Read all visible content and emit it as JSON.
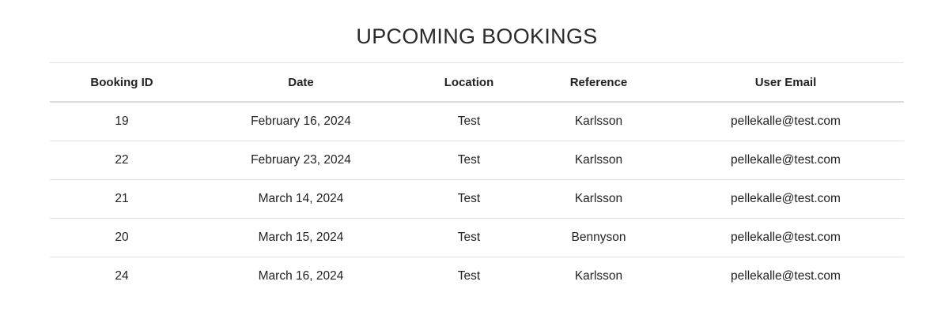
{
  "page": {
    "title": "UPCOMING BOOKINGS"
  },
  "table": {
    "headers": [
      "Booking ID",
      "Date",
      "Location",
      "Reference",
      "User Email"
    ],
    "rows": [
      [
        "19",
        "February 16, 2024",
        "Test",
        "Karlsson",
        "pellekalle@test.com"
      ],
      [
        "22",
        "February 23, 2024",
        "Test",
        "Karlsson",
        "pellekalle@test.com"
      ],
      [
        "21",
        "March 14, 2024",
        "Test",
        "Karlsson",
        "pellekalle@test.com"
      ],
      [
        "20",
        "March 15, 2024",
        "Test",
        "Bennyson",
        "pellekalle@test.com"
      ],
      [
        "24",
        "March 16, 2024",
        "Test",
        "Karlsson",
        "pellekalle@test.com"
      ]
    ]
  },
  "colors": {
    "text": "#222222",
    "divider": "#e2e2e2",
    "background": "#ffffff"
  }
}
